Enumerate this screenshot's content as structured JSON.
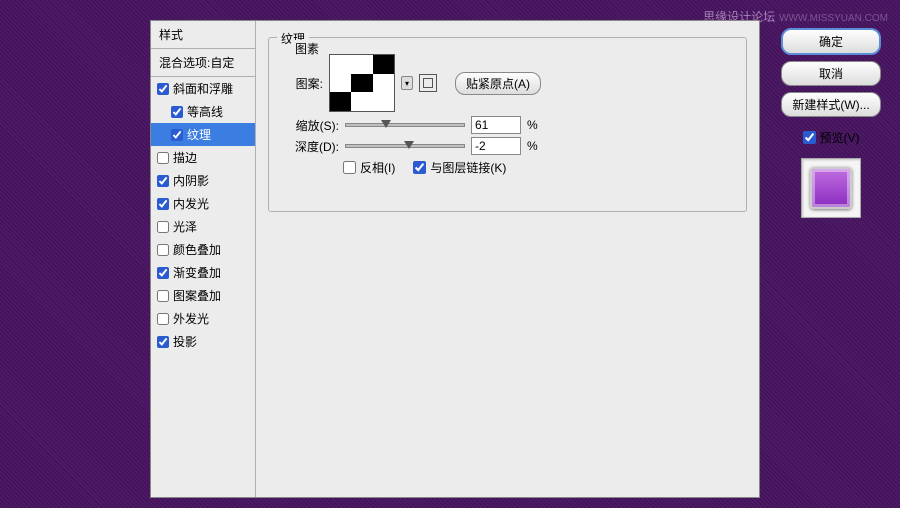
{
  "watermark": {
    "site": "思缘设计论坛",
    "url": "WWW.MISSYUAN.COM"
  },
  "sidebar": {
    "header": "样式",
    "blend": "混合选项:自定",
    "items": [
      {
        "label": "斜面和浮雕",
        "checked": true,
        "selected": false
      },
      {
        "label": "等高线",
        "checked": true,
        "selected": false,
        "sub": true
      },
      {
        "label": "纹理",
        "checked": true,
        "selected": true,
        "sub": true
      },
      {
        "label": "描边",
        "checked": false
      },
      {
        "label": "内阴影",
        "checked": true
      },
      {
        "label": "内发光",
        "checked": true
      },
      {
        "label": "光泽",
        "checked": false
      },
      {
        "label": "颜色叠加",
        "checked": false
      },
      {
        "label": "渐变叠加",
        "checked": true
      },
      {
        "label": "图案叠加",
        "checked": false
      },
      {
        "label": "外发光",
        "checked": false
      },
      {
        "label": "投影",
        "checked": true
      }
    ]
  },
  "main": {
    "group_title": "纹理",
    "subgroup_title": "图素",
    "pattern_label": "图案:",
    "snap_btn": "贴紧原点(A)",
    "scale_label": "缩放(S):",
    "scale_value": "61",
    "depth_label": "深度(D):",
    "depth_value": "-2",
    "percent": "%",
    "invert": "反相(I)",
    "link_layer": "与图层链接(K)"
  },
  "right": {
    "ok": "确定",
    "cancel": "取消",
    "new_style": "新建样式(W)...",
    "preview": "预览(V)"
  }
}
